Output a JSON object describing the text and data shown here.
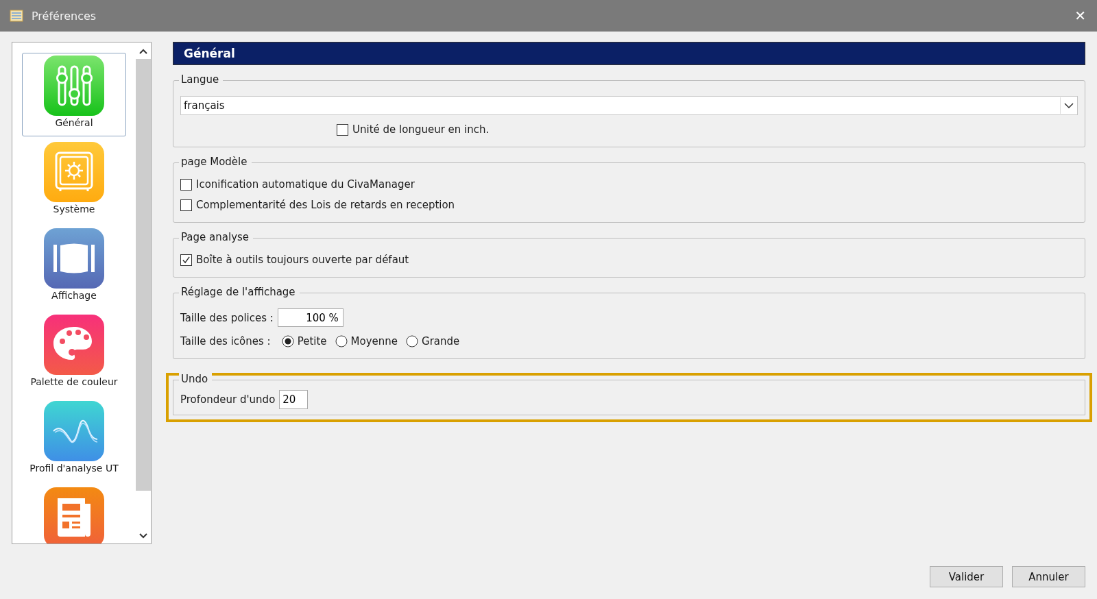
{
  "window": {
    "title": "Préférences",
    "close": "✕"
  },
  "sidebar": {
    "items": [
      {
        "label": "Général",
        "kind": "sliders",
        "selected": true
      },
      {
        "label": "Système",
        "kind": "safe",
        "selected": false
      },
      {
        "label": "Affichage",
        "kind": "display",
        "selected": false
      },
      {
        "label": "Palette de couleur",
        "kind": "palette",
        "selected": false
      },
      {
        "label": "Profil d'analyse UT",
        "kind": "wave",
        "selected": false
      },
      {
        "kind": "document",
        "selected": false
      }
    ]
  },
  "header": "Général",
  "groups": [
    {
      "title": "Langue",
      "highlighted": false,
      "rows": [
        {
          "kind": "combo",
          "value": "français"
        },
        {
          "kind": "checkbox",
          "label": "Unité de longueur en inch.",
          "checked": false
        }
      ]
    },
    {
      "title": "page Modèle",
      "highlighted": false,
      "rows": [
        {
          "kind": "checkbox",
          "label": "Iconification automatique du CivaManager",
          "checked": false
        },
        {
          "kind": "checkbox",
          "label": "Complementarité des Lois de retards en reception",
          "checked": false
        }
      ]
    },
    {
      "title": "Page analyse",
      "highlighted": false,
      "rows": [
        {
          "kind": "checkbox",
          "label": "Boîte à outils toujours ouverte par défaut",
          "checked": true
        }
      ]
    },
    {
      "title": "Réglage de l'affichage",
      "highlighted": false,
      "rows": [
        {
          "kind": "number",
          "label": "Taille des polices :",
          "value": "100 %"
        },
        {
          "kind": "radios",
          "label": "Taille des icônes :",
          "options": [
            {
              "label": "Petite",
              "selected": true
            },
            {
              "label": "Moyenne",
              "selected": false
            },
            {
              "label": "Grande",
              "selected": false
            }
          ]
        }
      ]
    },
    {
      "title": "Undo",
      "highlighted": true,
      "rows": [
        {
          "kind": "text",
          "label": "Profondeur d'undo",
          "value": "20"
        }
      ]
    }
  ],
  "buttons": [
    "Valider",
    "Annuler"
  ]
}
